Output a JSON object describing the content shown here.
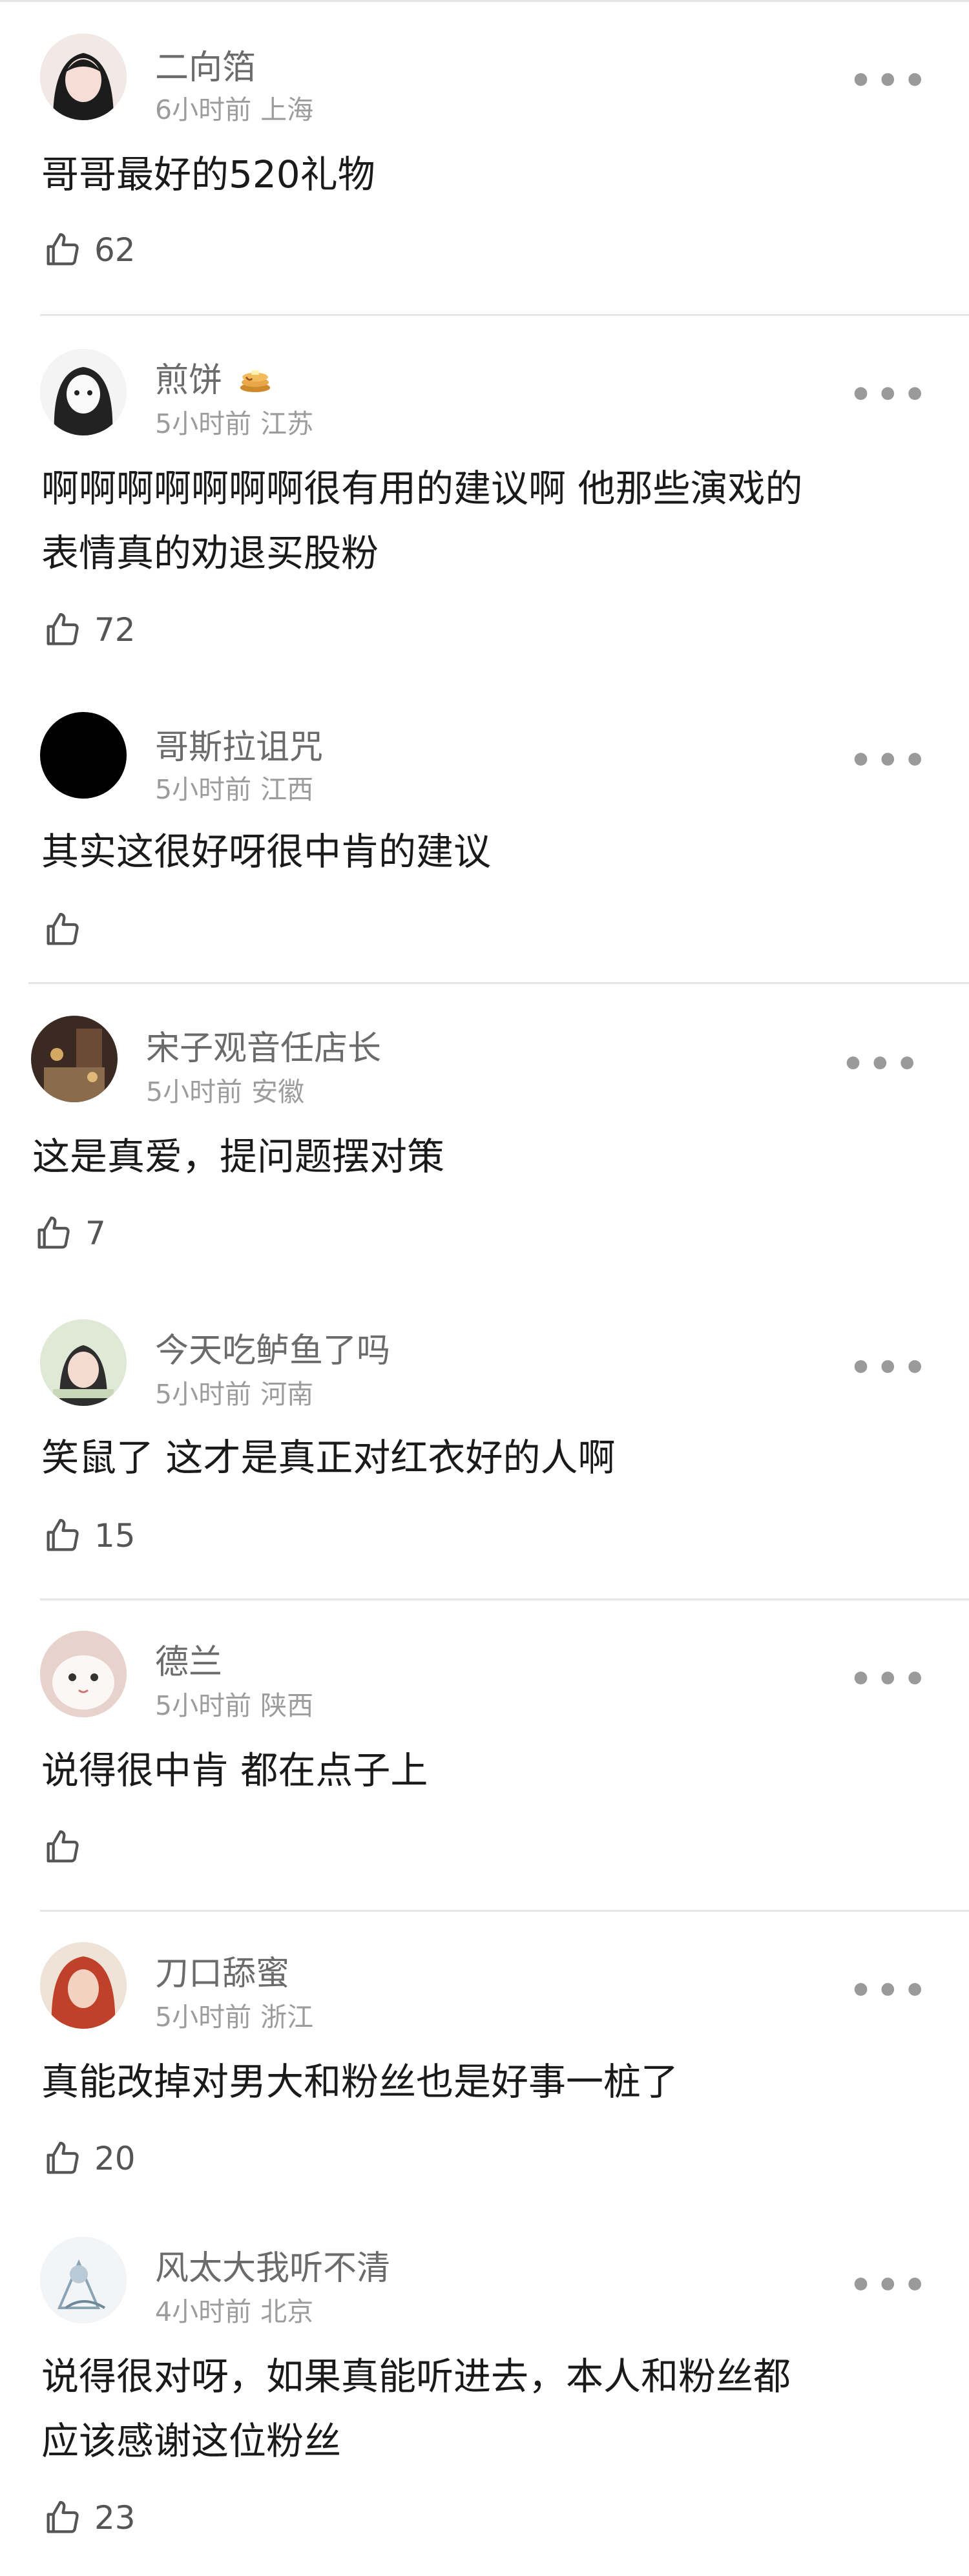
{
  "comments": [
    {
      "user": "二向箔",
      "time": "6小时前",
      "location": "上海",
      "text": "哥哥最好的520礼物",
      "likes": "62"
    },
    {
      "user": "煎饼",
      "time": "5小时前",
      "location": "江苏",
      "text_line1": "啊啊啊啊啊啊啊很有用的建议啊 他那些演戏的",
      "text_line2": "表情真的劝退买股粉",
      "likes": "72"
    },
    {
      "user": "哥斯拉诅咒",
      "time": "5小时前",
      "location": "江西",
      "text": "其实这很好呀很中肯的建议",
      "likes": ""
    },
    {
      "user": "宋子观音任店长",
      "time": "5小时前",
      "location": "安徽",
      "text": "这是真爱，提问题摆对策",
      "likes": "7"
    },
    {
      "user": "今天吃鲈鱼了吗",
      "time": "5小时前",
      "location": "河南",
      "text": "笑鼠了 这才是真正对红衣好的人啊",
      "likes": "15"
    },
    {
      "user": "德兰",
      "time": "5小时前",
      "location": "陕西",
      "text": "说得很中肯 都在点子上",
      "likes": ""
    },
    {
      "user": "刀口舔蜜",
      "time": "5小时前",
      "location": "浙江",
      "text": "真能改掉对男大和粉丝也是好事一桩了",
      "likes": "20"
    },
    {
      "user": "风太大我听不清",
      "time": "4小时前",
      "location": "北京",
      "text_line1": "说得很对呀，如果真能听进去，本人和粉丝都",
      "text_line2": "应该感谢这位粉丝",
      "likes": "23"
    }
  ],
  "more_glyph": "•••",
  "icons": {
    "like": "thumbs-up-icon",
    "more": "more-options-icon",
    "pancake": "pancake-emoji-icon"
  }
}
